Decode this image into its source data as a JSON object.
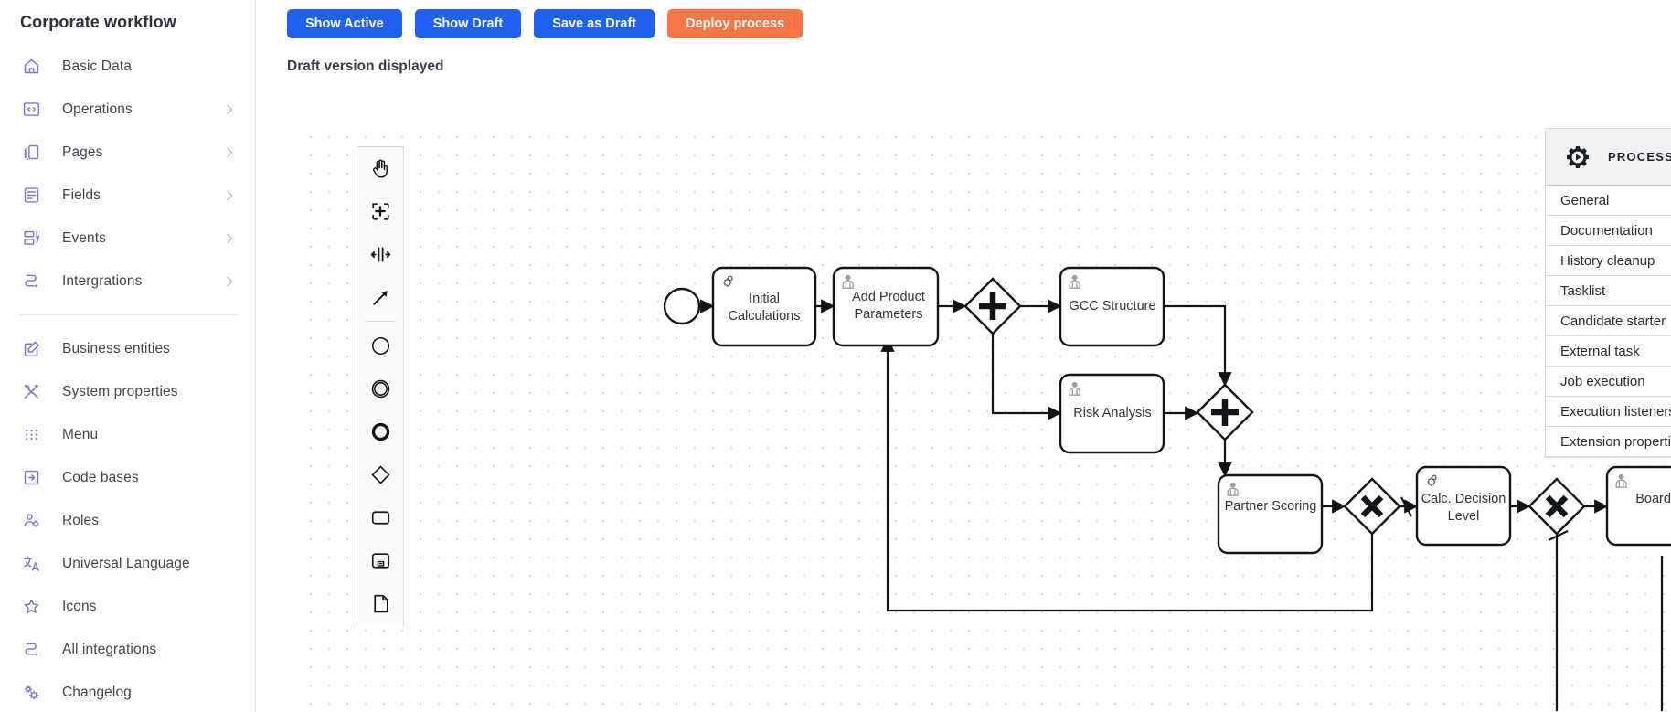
{
  "sidebar": {
    "title": "Corporate workflow",
    "items": [
      {
        "label": "Basic Data",
        "icon": "home-icon",
        "chevron": false
      },
      {
        "label": "Operations",
        "icon": "code-icon",
        "chevron": true
      },
      {
        "label": "Pages",
        "icon": "pages-icon",
        "chevron": true
      },
      {
        "label": "Fields",
        "icon": "fields-icon",
        "chevron": true
      },
      {
        "label": "Events",
        "icon": "events-icon",
        "chevron": true
      },
      {
        "label": "Intergrations",
        "icon": "integration-icon",
        "chevron": true
      }
    ],
    "items2": [
      {
        "label": "Business entities",
        "icon": "edit-square-icon"
      },
      {
        "label": "System properties",
        "icon": "tools-icon"
      },
      {
        "label": "Menu",
        "icon": "grid-dots-icon"
      },
      {
        "label": "Code bases",
        "icon": "code-base-icon"
      },
      {
        "label": "Roles",
        "icon": "user-gear-icon"
      },
      {
        "label": "Universal Language",
        "icon": "translate-icon"
      },
      {
        "label": "Icons",
        "icon": "star-icon"
      },
      {
        "label": "All integrations",
        "icon": "integration-icon"
      },
      {
        "label": "Changelog",
        "icon": "gears-icon"
      }
    ]
  },
  "toolbar": {
    "show_active": "Show Active",
    "show_draft": "Show Draft",
    "save_as_draft": "Save as Draft",
    "deploy_process": "Deploy process",
    "primary_color": "#1f62f2",
    "accent_color": "#f87548"
  },
  "status": {
    "text": "Draft version displayed"
  },
  "palette": {
    "tools": [
      {
        "name": "hand-tool-icon"
      },
      {
        "name": "lasso-tool-icon"
      },
      {
        "name": "space-tool-icon"
      },
      {
        "name": "connect-tool-icon"
      }
    ],
    "shapes": [
      {
        "name": "start-event-icon"
      },
      {
        "name": "intermediate-event-icon"
      },
      {
        "name": "end-event-icon"
      },
      {
        "name": "gateway-icon"
      },
      {
        "name": "task-icon"
      },
      {
        "name": "subprocess-icon"
      },
      {
        "name": "data-object-icon"
      }
    ]
  },
  "diagram": {
    "nodes": [
      {
        "id": "start",
        "type": "start-event",
        "label": ""
      },
      {
        "id": "initcalc",
        "type": "service-task",
        "label": "Initial\nCalculations"
      },
      {
        "id": "addparams",
        "type": "user-task",
        "label": "Add Product\nParameters"
      },
      {
        "id": "gwsplit",
        "type": "parallel-gateway",
        "label": ""
      },
      {
        "id": "gcc",
        "type": "user-task",
        "label": "GCC Structure"
      },
      {
        "id": "risk",
        "type": "user-task",
        "label": "Risk Analysis"
      },
      {
        "id": "gwjoin",
        "type": "parallel-gateway",
        "label": ""
      },
      {
        "id": "partner",
        "type": "user-task",
        "label": "Partner Scoring"
      },
      {
        "id": "gwx1",
        "type": "exclusive-gateway",
        "label": ""
      },
      {
        "id": "calcdec",
        "type": "service-task",
        "label": "Calc. Decision\nLevel"
      },
      {
        "id": "gwx2",
        "type": "exclusive-gateway",
        "label": ""
      },
      {
        "id": "boarda",
        "type": "user-task",
        "label": "Board A"
      }
    ]
  },
  "properties": {
    "header_title": "PROCESS",
    "header_icon": "process-gear-icon",
    "rows": [
      {
        "label": "General",
        "dot": true,
        "control": "chevron"
      },
      {
        "label": "Documentation",
        "dot": false,
        "control": "chevron"
      },
      {
        "label": "History cleanup",
        "dot": false,
        "control": "chevron"
      },
      {
        "label": "Tasklist",
        "dot": false,
        "control": "chevron"
      },
      {
        "label": "Candidate starter",
        "dot": false,
        "control": "chevron"
      },
      {
        "label": "External task",
        "dot": false,
        "control": "chevron"
      },
      {
        "label": "Job execution",
        "dot": false,
        "control": "chevron"
      },
      {
        "label": "Execution listeners",
        "dot": false,
        "control": "plus"
      },
      {
        "label": "Extension properties",
        "dot": false,
        "control": "plus"
      }
    ]
  }
}
